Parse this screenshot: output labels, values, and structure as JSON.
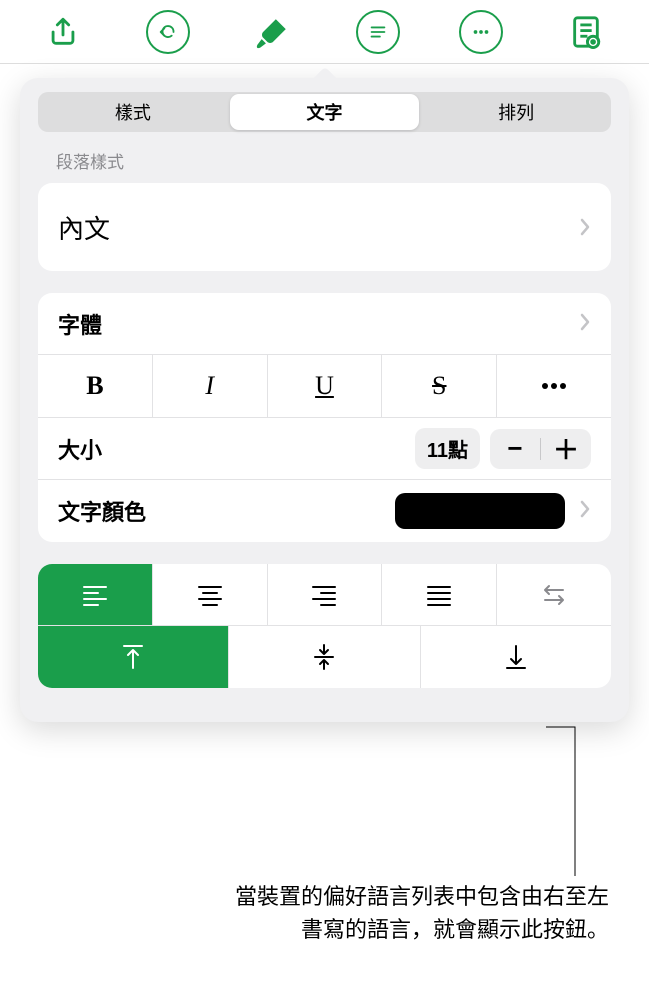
{
  "toolbar": {
    "share": "share-icon",
    "undo": "undo-icon",
    "format": "paintbrush-icon",
    "insert": "insert-icon",
    "more": "more-icon",
    "view": "document-view-icon"
  },
  "tabs": {
    "style": "樣式",
    "text": "文字",
    "arrange": "排列",
    "selected": "text"
  },
  "paragraph": {
    "section_label": "段落樣式",
    "current": "內文"
  },
  "font": {
    "label": "字體",
    "bold": "B",
    "italic": "I",
    "underline": "U",
    "strike": "S"
  },
  "size": {
    "label": "大小",
    "value": "11點"
  },
  "color": {
    "label": "文字顏色",
    "value": "#000000"
  },
  "align": {
    "h_selected": "left",
    "v_selected": "top",
    "rtl_button": "rtl-direction-icon"
  },
  "callout": {
    "line1": "當裝置的偏好語言列表中包含由右至左",
    "line2": "書寫的語言，就會顯示此按鈕。"
  }
}
